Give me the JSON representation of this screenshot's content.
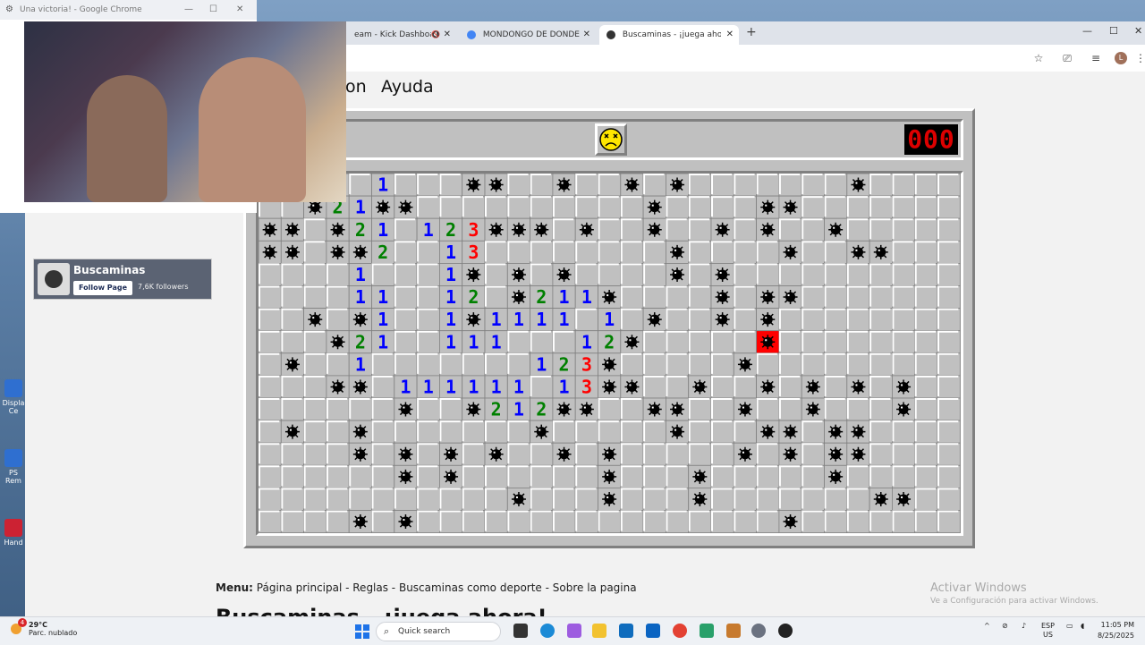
{
  "popup": {
    "title": "Una victoria! - Google Chrome",
    "controls": {
      "minimize": "—",
      "maximize": "☐",
      "close": "✕"
    }
  },
  "browser": {
    "tabs": [
      {
        "label": "eam - Kick Dashboard",
        "muted_icon": "🔇",
        "close": "✕",
        "favicon_color": "#53fc18"
      },
      {
        "label": "MONDONGO DE DONDE VIENE",
        "close": "✕",
        "favicon_color": "#4285f4"
      },
      {
        "label": "Buscaminas - ¡juega ahora!",
        "close": "✕",
        "favicon_color": "#333333",
        "active": true
      }
    ],
    "new_tab": "+",
    "window_controls": {
      "minimize": "—",
      "maximize": "☐",
      "close": "✕"
    },
    "profile_initial": "L"
  },
  "page": {
    "menubar": {
      "item_partial": "on",
      "help": "Ayuda"
    },
    "game": {
      "face": "dead",
      "mine_counter": "000",
      "cols": 31,
      "rows": 16,
      "exploded_cell": [
        7,
        25
      ]
    },
    "footer_menu": {
      "label": "Menu:",
      "links": "Página principal - Reglas - Buscaminas como deporte - Sobre la pagina"
    },
    "title": "Buscaminas - ¡juega ahora!",
    "watermark": {
      "line1": "Activar Windows",
      "line2": "Ve a Configuración para activar Windows."
    }
  },
  "fb_card": {
    "name": "Buscaminas",
    "follow_label": "Follow Page",
    "followers": "7,6K followers"
  },
  "desktop_icons": [
    {
      "label": "Displa Ce"
    },
    {
      "label": "PS Rem"
    },
    {
      "label": "Hand"
    }
  ],
  "taskbar": {
    "weather_temp": "29°C",
    "weather_desc": "Parc. nublado",
    "notification_count": "4",
    "search_placeholder": "Quick search",
    "lang_top": "ESP",
    "lang_bottom": "US",
    "time": "11:05 PM",
    "date": "8/25/2025"
  },
  "board": [
    "..M1.1...MM..M..M.M.......M",
    "..M21MM..........M....MM.",
    "MM.M21.123MMM.M..M..M.M..M.",
    "MM.MM2..13........M....M..MM",
    "....1...1M.M.M....M.M....",
    "....11..12.M211M....M.MM",
    "..M.M1..1M1111.1.M..M.M",
    "...M21..111...12M.....X",
    ".M..1.......123M.....M",
    "...MM.111111.13MM..M..M.M.M.M",
    "......M..M212MM..MM..M..M...M",
    ".M..M.......M.....M...MM.MM",
    "....M.M.M.M..M.M.....M.M.MM",
    "......M.M......M...M.....M",
    "...........M...M...M.......MM",
    "....M.M................M"
  ]
}
